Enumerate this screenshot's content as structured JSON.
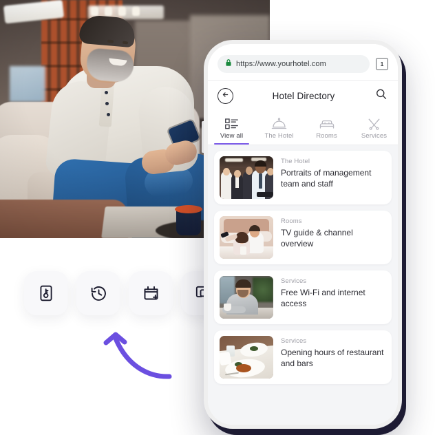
{
  "browser": {
    "url": "https://www.yourhotel.com",
    "lock_icon": "lock-icon",
    "tab_count": "1",
    "lock_color": "#1a8a3e"
  },
  "app_header": {
    "back_icon": "arrow-left-circle-icon",
    "title": "Hotel Directory",
    "search_icon": "search-icon"
  },
  "tabs": [
    {
      "label": "View all",
      "icon": "list-view-icon",
      "active": true
    },
    {
      "label": "The Hotel",
      "icon": "service-bell-icon",
      "active": false
    },
    {
      "label": "Rooms",
      "icon": "bed-icon",
      "active": false
    },
    {
      "label": "Services",
      "icon": "fork-knife-icon",
      "active": false
    }
  ],
  "active_tab_color": "#7b5be8",
  "cards": [
    {
      "category": "The Hotel",
      "title": "Portraits of management team and staff",
      "thumb": "staff-group-photo"
    },
    {
      "category": "Rooms",
      "title": "TV guide & channel overview",
      "thumb": "couple-watching-tv-photo"
    },
    {
      "category": "Services",
      "title": "Free Wi-Fi and internet access",
      "thumb": "man-with-laptop-photo"
    },
    {
      "category": "Services",
      "title": "Opening hours of restaurant and bars",
      "thumb": "restaurant-plates-photo"
    }
  ],
  "tiles": [
    {
      "icon": "key-card-icon"
    },
    {
      "icon": "history-clock-icon"
    },
    {
      "icon": "calendar-plus-icon"
    },
    {
      "icon": "chat-bubble-icon"
    }
  ],
  "decoration": {
    "arrow_icon": "curved-arrow-icon",
    "arrow_color": "#6b4fe0"
  },
  "hero": {
    "alt": "smiling-man-on-couch-using-smartphone"
  }
}
